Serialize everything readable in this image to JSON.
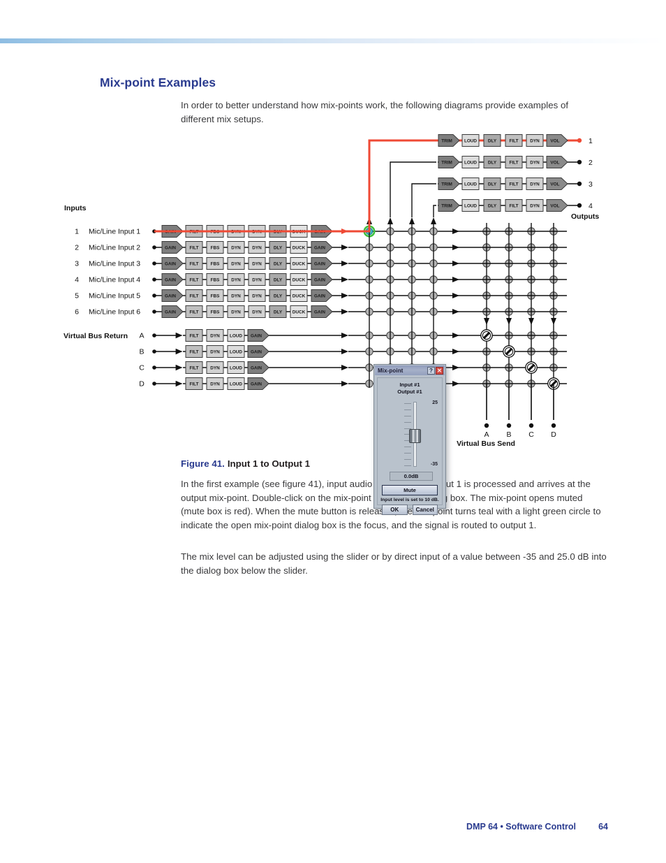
{
  "page": {
    "heading": "Mix-point Examples",
    "intro": "In order to better understand how mix-points work, the following diagrams provide examples of different mix setups.",
    "figure_number": "Figure 41.",
    "figure_title": "Input 1 to Output 1",
    "paragraph_1": "In the first example (see figure 41), input audio from Mic/Line Input 1 is processed and arrives at the output mix-point. Double-click on the mix-point to open the dialog box. The mix-point opens muted (mute box is red). When the mute button is released, the mix-point turns teal with a light green circle to indicate the open mix-point dialog box is the focus, and the signal is routed to output 1.",
    "paragraph_2": "The mix level can be adjusted using the slider or by direct input of a value between -35 and 25.0 dB into the dialog box below the slider.",
    "footer_text": "DMP 64 • Software Control",
    "footer_page": "64"
  },
  "diagram": {
    "inputs_label": "Inputs",
    "outputs_label": "Outputs",
    "virtual_bus_return_label": "Virtual Bus Return",
    "virtual_bus_send_label": "Virtual Bus Send",
    "input_rows": [
      {
        "num": "1",
        "name": "Mic/Line Input 1",
        "active": true
      },
      {
        "num": "2",
        "name": "Mic/Line Input 2",
        "active": false
      },
      {
        "num": "3",
        "name": "Mic/Line Input 3",
        "active": false
      },
      {
        "num": "4",
        "name": "Mic/Line Input 4",
        "active": false
      },
      {
        "num": "5",
        "name": "Mic/Line Input 5",
        "active": false
      },
      {
        "num": "6",
        "name": "Mic/Line Input 6",
        "active": false
      }
    ],
    "input_chain_blocks": [
      "GAIN",
      "FILT",
      "FBS",
      "DYN",
      "DYN",
      "DLY",
      "DUCK",
      "GAIN"
    ],
    "return_rows": [
      "A",
      "B",
      "C",
      "D"
    ],
    "return_chain_blocks": [
      "FILT",
      "DYN",
      "LOUD",
      "GAIN"
    ],
    "output_rows": [
      {
        "num": "1",
        "active": true
      },
      {
        "num": "2",
        "active": false
      },
      {
        "num": "3",
        "active": false
      },
      {
        "num": "4",
        "active": false
      }
    ],
    "output_chain_blocks": [
      "TRIM",
      "LOUD",
      "DLY",
      "FILT",
      "DYN",
      "VOL"
    ],
    "bus_send_columns": [
      "A",
      "B",
      "C",
      "D"
    ],
    "colors": {
      "signal_path": "#ef4a35",
      "active_mixpoint_fill": "#3fb8c8",
      "active_mixpoint_ring": "#3fc23f",
      "mixpoint_fill": "#b5b5b5",
      "heading": "#2a3b8f"
    }
  },
  "dialog": {
    "title": "Mix-point",
    "help_button": "?",
    "close_button": "✕",
    "heading_line1": "Input #1",
    "heading_line2": "Output #1",
    "slider_max": "25",
    "slider_min": "-35",
    "level_value": "0.0dB",
    "mute_label": "Mute",
    "hint": "Input level is set to 10 dB.",
    "ok_label": "OK",
    "cancel_label": "Cancel"
  }
}
